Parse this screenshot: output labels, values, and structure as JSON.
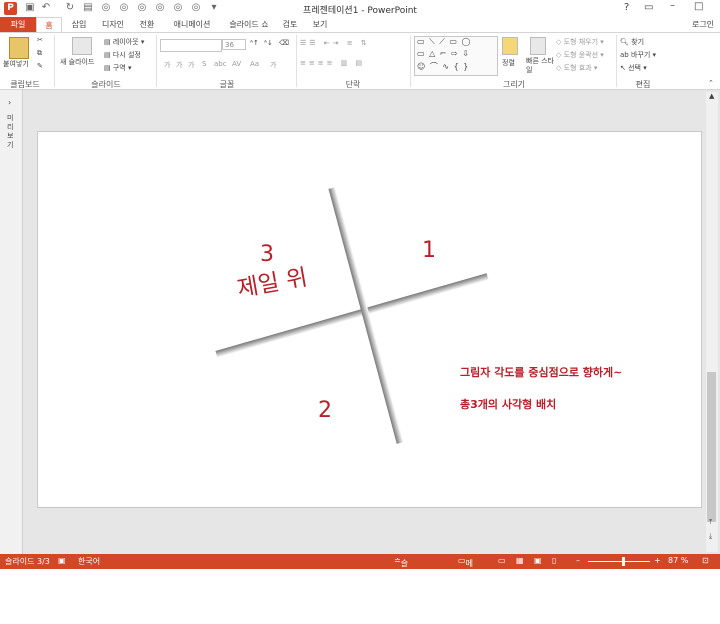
{
  "window": {
    "title": "프레젠테이션1 - PowerPoint",
    "signin": "로그인",
    "help": "?",
    "app_icon": "P"
  },
  "tabs": [
    "파일",
    "홈",
    "삽입",
    "디자인",
    "전환",
    "애니메이션",
    "슬라이드 쇼",
    "검토",
    "보기"
  ],
  "ribbon": {
    "clipboard": {
      "label": "클립보드",
      "paste": "붙여넣기"
    },
    "slides": {
      "label": "슬라이드",
      "new_slide": "새 슬라이드",
      "layout": "레이아웃",
      "reset": "다시 설정",
      "section": "구역"
    },
    "font": {
      "label": "글꼴",
      "size": "36",
      "buttons": [
        "가",
        "가",
        "가",
        "S",
        "abc",
        "AV",
        "Aa",
        "가"
      ]
    },
    "paragraph": {
      "label": "단락"
    },
    "drawing": {
      "label": "그리기",
      "arrange": "정렬",
      "quick_styles": "빠른 스타일",
      "shape_fill": "도형 채우기",
      "shape_outline": "도형 윤곽선",
      "shape_effects": "도형 효과"
    },
    "editing": {
      "label": "편집",
      "find": "찾기",
      "replace": "바꾸기",
      "select": "선택"
    }
  },
  "left_pane": {
    "label": "미리 보기"
  },
  "slide": {
    "q3_number": "3",
    "q3_text": "제일 위",
    "q1": "1",
    "q2": "2",
    "note1": "그림자 각도를 중심점으로 향하게~",
    "note2": "총3개의 사각형 배치",
    "text_color": "#b8202a"
  },
  "status": {
    "slide": "슬라이드 3/3",
    "language": "한국어",
    "notes": "슬라이드 노트",
    "comments": "메모",
    "zoom": "87 %",
    "zoom_fraction": 0.55
  },
  "colors": {
    "accent": "#d24726"
  }
}
